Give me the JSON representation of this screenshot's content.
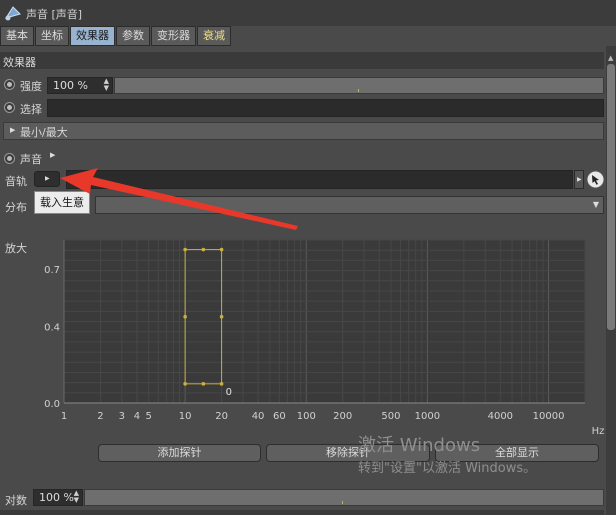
{
  "window": {
    "title": "声音 [声音]",
    "icon": "speaker-cone-icon"
  },
  "tabs": [
    {
      "label": "基本",
      "active": false
    },
    {
      "label": "坐标",
      "active": false
    },
    {
      "label": "效果器",
      "active": true
    },
    {
      "label": "参数",
      "active": false
    },
    {
      "label": "变形器",
      "active": false
    },
    {
      "label": "衰减",
      "active": false
    }
  ],
  "section": {
    "title": "效果器"
  },
  "params": {
    "strength": {
      "label": "强度",
      "value": "100 %"
    },
    "selection": {
      "label": "选择"
    },
    "minmax": {
      "label": "最小/最大"
    },
    "sound": {
      "label": "声音"
    },
    "track": {
      "label": "音轨"
    },
    "distribution": {
      "label": "分布"
    },
    "amplify": {
      "label": "放大"
    }
  },
  "tooltip": {
    "text": "载入生意"
  },
  "chart_data": {
    "type": "line",
    "x_scale": "log",
    "xlim": [
      1,
      20000
    ],
    "ylim": [
      0,
      0.85
    ],
    "x_ticks": [
      "1",
      "2",
      "3",
      "4",
      "5",
      "10",
      "20",
      "40",
      "60",
      "100",
      "200",
      "500",
      "1000",
      "4000",
      "10000"
    ],
    "y_ticks": [
      "0.0",
      "0.4",
      "0.7"
    ],
    "x_unit": "Hz",
    "probe": {
      "x": [
        10,
        20
      ],
      "y": [
        0.1,
        0.8
      ],
      "label": "0"
    },
    "grid": true
  },
  "buttons": {
    "add_probe": "添加探针",
    "remove_probe": "移除探针",
    "show_all": "全部显示"
  },
  "log_param": {
    "label": "对数",
    "value": "100 %"
  },
  "watermark": {
    "line1": "激活 Windows",
    "line2": "转到\"设置\"以激活 Windows。"
  },
  "colors": {
    "accent": "#98b3cf",
    "probe": "#c8b040",
    "arrow": "#e8382a"
  }
}
